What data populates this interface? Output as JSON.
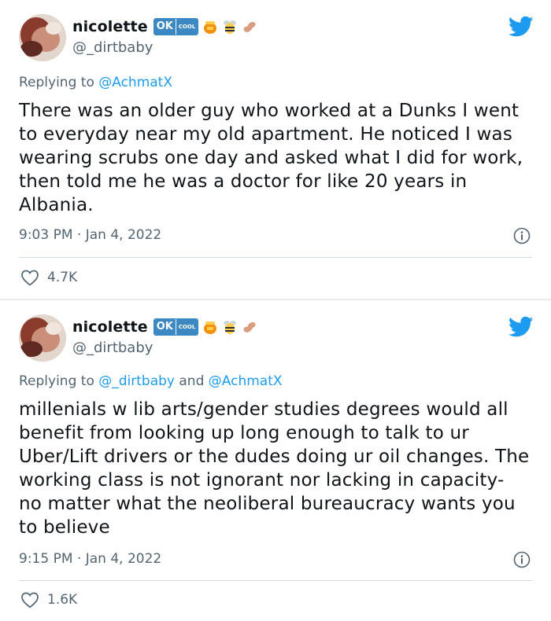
{
  "tweets": [
    {
      "author": {
        "display_name": "nicolette",
        "handle": "@_dirtbaby",
        "badges": [
          "ok-cool-icon",
          "honey-pot-icon",
          "bee-icon",
          "peanut-icon"
        ]
      },
      "replying_prefix": "Replying to ",
      "replying_to": [
        "@AchmatX"
      ],
      "text": "There was an older guy who worked at a Dunks I went to everyday near my old apartment. He noticed I was wearing scrubs one day and asked what I did for work, then told me he was a doctor for like 20 years in Albania.",
      "time": "9:03 PM",
      "date": "Jan 4, 2022",
      "likes": "4.7K"
    },
    {
      "author": {
        "display_name": "nicolette",
        "handle": "@_dirtbaby",
        "badges": [
          "ok-cool-icon",
          "honey-pot-icon",
          "bee-icon",
          "peanut-icon"
        ]
      },
      "replying_prefix": "Replying to ",
      "replying_to": [
        "@_dirtbaby",
        "@AchmatX"
      ],
      "replying_joiner": " and ",
      "text": "millenials w lib arts/gender studies degrees would all benefit from looking up long enough to talk to ur Uber/Lift drivers or the dudes doing ur oil changes. The working class is not ignorant nor lacking in capacity- no matter what the neoliberal bureaucracy wants you to believe",
      "time": "9:15 PM",
      "date": "Jan 4, 2022",
      "likes": "1.6K"
    }
  ],
  "badge_labels": {
    "ok": "OK",
    "cool": "COOL"
  },
  "meta_separator": " · ",
  "colors": {
    "twitter_blue": "#1d9bf0",
    "muted": "#536471",
    "divider": "#cfd9de",
    "ok_badge": "#3b88c3"
  }
}
